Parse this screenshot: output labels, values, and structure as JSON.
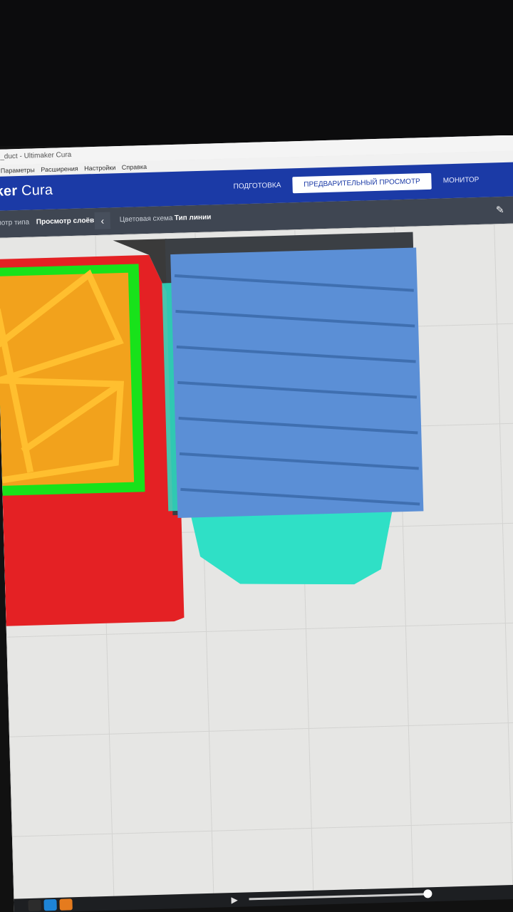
{
  "window": {
    "title": "_duct - Ultimaker Cura"
  },
  "menu": {
    "items": [
      "Параметры",
      "Расширения",
      "Настройки",
      "Справка"
    ]
  },
  "header": {
    "brand_prefix": "ker",
    "brand_name": "Cura",
    "stages": [
      {
        "label": "ПОДГОТОВКА",
        "active": false
      },
      {
        "label": "ПРЕДВАРИТЕЛЬНЫЙ ПРОСМОТР",
        "active": true
      },
      {
        "label": "МОНИТОР",
        "active": false
      }
    ]
  },
  "viewbar": {
    "view_type": "мотр типа",
    "layer_view": "Просмотр слоёв",
    "color_scheme_label": "Цветовая схема",
    "color_scheme_value": "Тип линии"
  },
  "colors": {
    "header_blue": "#1b3aa6",
    "wall_red": "#e42124",
    "inner_wall_green": "#18e21a",
    "infill_orange": "#f2a21c",
    "support_blue": "#5b8fd6",
    "skirt_cyan": "#2fe0c6"
  },
  "icons": {
    "back": "chevron-left-icon",
    "edit": "pencil-icon",
    "play": "play-icon"
  }
}
